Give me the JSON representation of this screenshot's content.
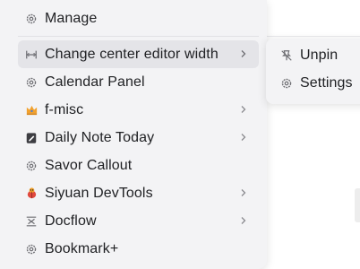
{
  "menu": {
    "items": [
      {
        "label": "Manage",
        "icon": "gear-icon",
        "has_submenu": false
      },
      {
        "label": "Change center editor width",
        "icon": "width-resize-icon",
        "has_submenu": true,
        "highlighted": true
      },
      {
        "label": "Calendar Panel",
        "icon": "gear-icon",
        "has_submenu": false
      },
      {
        "label": "f-misc",
        "icon": "crown-icon",
        "has_submenu": true
      },
      {
        "label": "Daily Note Today",
        "icon": "notebook-icon",
        "has_submenu": true
      },
      {
        "label": "Savor Callout",
        "icon": "gear-icon",
        "has_submenu": false
      },
      {
        "label": "Siyuan DevTools",
        "icon": "bug-icon",
        "has_submenu": true
      },
      {
        "label": "Docflow",
        "icon": "docflow-icon",
        "has_submenu": true
      },
      {
        "label": "Bookmark+",
        "icon": "gear-icon",
        "has_submenu": false
      }
    ]
  },
  "submenu": {
    "items": [
      {
        "label": "Unpin",
        "icon": "unpin-icon"
      },
      {
        "label": "Settings",
        "icon": "gear-icon"
      }
    ]
  },
  "colors": {
    "menu_bg": "#f3f3f5",
    "highlight_bg": "#e4e4e8",
    "icon_gray": "#6e6e73",
    "crown_orange": "#f2a12c",
    "bug_red": "#e0483e"
  }
}
